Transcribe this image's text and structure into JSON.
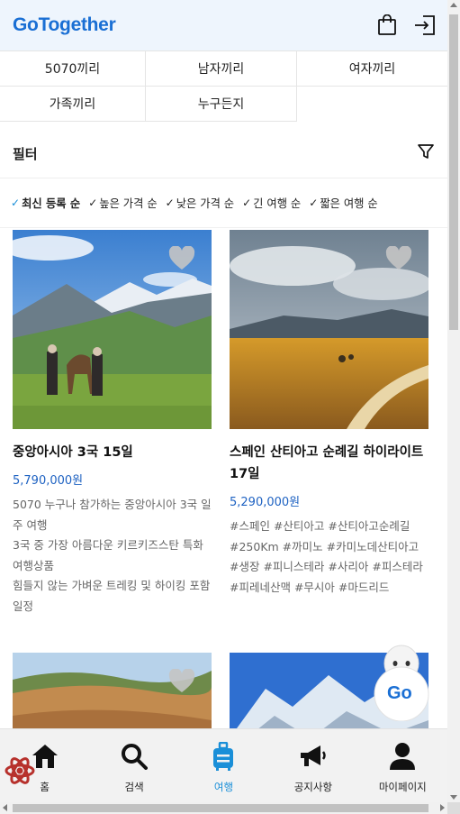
{
  "header": {
    "logo_prefix": "Go",
    "logo_suffix": " Together",
    "icons": [
      "shopping-bag-icon",
      "login-icon"
    ]
  },
  "categories": [
    "5070끼리",
    "남자끼리",
    "여자끼리",
    "가족끼리",
    "누구든지"
  ],
  "filter": {
    "title": "필터",
    "icon": "filter-icon"
  },
  "sort_options": [
    {
      "label": "최신 등록 순",
      "active": true
    },
    {
      "label": "높은 가격 순",
      "active": false
    },
    {
      "label": "낮은 가격 순",
      "active": false
    },
    {
      "label": "긴 여행 순",
      "active": false
    },
    {
      "label": "짧은 여행 순",
      "active": false
    }
  ],
  "products": [
    {
      "title": "중앙아시아 3국 15일",
      "price": "5,790,000원",
      "desc_lines": [
        "5070 누구나 참가하는 중앙아시아 3국 일주 여행",
        "3국 중 가장 아름다운 키르키즈스탄 특화 여행상품",
        "힘들지 않는 가벼운 트레킹 및 하이킹 포함 일정"
      ]
    },
    {
      "title": "스페인 산티아고 순례길 하이라이트 17일",
      "price": "5,290,000원",
      "desc_lines": [
        "#스페인 #산티아고 #산티아고순례길 #250Km #까미노 #카미노데산티아고 #생장 #피니스테라 #사리아 #피스테라 #피레네산맥 #무시아 #마드리드"
      ]
    }
  ],
  "bottom_nav": [
    {
      "label": "홈",
      "icon": "home-icon",
      "active": false
    },
    {
      "label": "검색",
      "icon": "search-icon",
      "active": false
    },
    {
      "label": "여행",
      "icon": "suitcase-icon",
      "active": true
    },
    {
      "label": "공지사항",
      "icon": "megaphone-icon",
      "active": false
    },
    {
      "label": "마이페이지",
      "icon": "user-icon",
      "active": false
    }
  ],
  "floating_button": {
    "label": "Go"
  },
  "colors": {
    "brand_blue": "#1a6fd4",
    "brand_orange": "#f2a31a",
    "price_blue": "#1e62c2",
    "active_nav": "#1a8fd8",
    "header_bg": "#eef5fd"
  }
}
